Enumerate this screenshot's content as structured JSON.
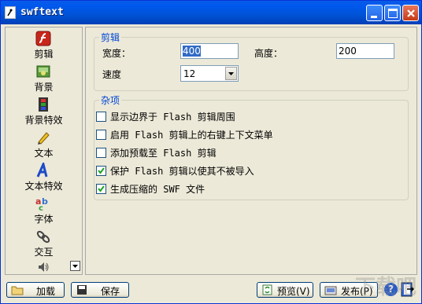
{
  "window": {
    "title": "swftext"
  },
  "sidebar": {
    "items": [
      {
        "label": "剪辑",
        "icon": "flash-icon"
      },
      {
        "label": "背景",
        "icon": "background-icon"
      },
      {
        "label": "背景特效",
        "icon": "film-strip-icon"
      },
      {
        "label": "文本",
        "icon": "pencil-icon"
      },
      {
        "label": "文本特效",
        "icon": "text-effect-icon"
      },
      {
        "label": "字体",
        "icon": "font-icon"
      },
      {
        "label": "交互",
        "icon": "link-icon"
      }
    ],
    "more_icon": "speaker-icon"
  },
  "clip_group": {
    "title": "剪辑",
    "width_label": "宽度：",
    "width_value": "400",
    "height_label": "高度：",
    "height_value": "200",
    "speed_label": "速度",
    "speed_value": "12"
  },
  "misc_group": {
    "title": "杂项",
    "options": [
      {
        "label": "显示边界于 Flash 剪辑周围",
        "checked": false
      },
      {
        "label": "启用 Flash 剪辑上的右键上下文菜单",
        "checked": false
      },
      {
        "label": "添加预载至 Flash 剪辑",
        "checked": false
      },
      {
        "label": "保护 Flash 剪辑以使其不被导入",
        "checked": true
      },
      {
        "label": "生成压缩的 SWF 文件",
        "checked": true
      }
    ]
  },
  "bottom": {
    "load_label": "加载",
    "save_label": "保存",
    "preview_label": "预览(V)",
    "publish_label": "发布(P)"
  },
  "watermark": "下载吧"
}
